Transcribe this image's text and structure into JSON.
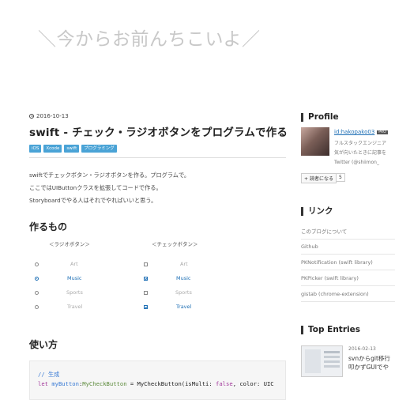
{
  "blog": {
    "title": "＼今からお前んちこいよ／"
  },
  "post": {
    "date": "2016-10-13",
    "title": "swift - チェック・ラジオボタンをプログラムで作る",
    "tags": [
      "iOS",
      "Xcode",
      "swift",
      "プログラミング"
    ],
    "intro": [
      "swiftでチェックボタン・ラジオボタンを作る。プログラムで。",
      "ここではUIButtonクラスを拡張してコードで作る。",
      "Storyboardでやる人はそれでやればいいと思う。"
    ],
    "section1": "作るもの",
    "radio_header": "＜ラジオボタン＞",
    "check_header": "＜チェックボタン＞",
    "radio_options": [
      {
        "label": "Art",
        "selected": false
      },
      {
        "label": "Music",
        "selected": true
      },
      {
        "label": "Sports",
        "selected": false
      },
      {
        "label": "Travel",
        "selected": false
      }
    ],
    "check_options": [
      {
        "label": "Art",
        "checked": false
      },
      {
        "label": "Music",
        "checked": true
      },
      {
        "label": "Sports",
        "checked": false
      },
      {
        "label": "Travel",
        "checked": true
      }
    ],
    "section2": "使い方",
    "code": {
      "line1": "// 生成",
      "line2_let": "let ",
      "line2_var": "myButton",
      "line2_colon": ":",
      "line2_type": "MyCheckButton",
      "line2_rest": " = MyCheckButton(isMulti: ",
      "line2_false": "false",
      "line2_tail": ", color: UIC"
    }
  },
  "sidebar": {
    "profile_heading": "Profile",
    "profile_name": "id:hakopako03",
    "pro_badge": "PRO",
    "profile_desc": [
      "フルスタックエンジニア",
      "気が向いたときに記事を",
      "Twitter (@shiimon_"
    ],
    "reader_button": "読者になる",
    "reader_count": "5",
    "links_heading": "リンク",
    "links": [
      "このブログについて",
      "Github",
      "PKNotification (swift library)",
      "PKPicker (swift library)",
      "gistab (chrome-extension)"
    ],
    "top_heading": "Top Entries",
    "top_entry_date": "2016-02-13",
    "top_entry_title": [
      "svnからgit移行",
      "叩かずGUIでや"
    ]
  },
  "colors": {
    "accent": "#1e6fb5",
    "tag_bg": "#4aa3d6",
    "title_gray": "#c8c8c8"
  }
}
